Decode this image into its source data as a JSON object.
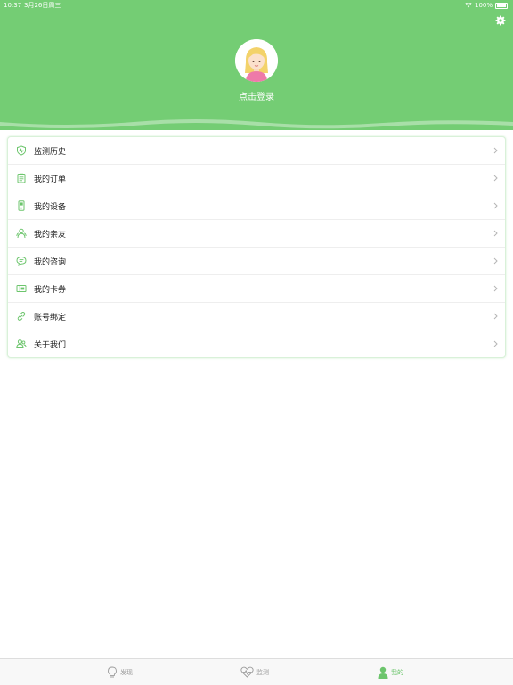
{
  "status_bar": {
    "time": "10:37",
    "date": "3月26日周三",
    "battery": "100%"
  },
  "header": {
    "login_text": "点击登录",
    "background_color": "#74cd74",
    "settings_icon": "gear-icon"
  },
  "menu": {
    "items": [
      {
        "label": "监测历史",
        "icon": "shield-icon"
      },
      {
        "label": "我的订单",
        "icon": "clipboard-icon"
      },
      {
        "label": "我的设备",
        "icon": "device-icon"
      },
      {
        "label": "我的亲友",
        "icon": "friends-icon"
      },
      {
        "label": "我的咨询",
        "icon": "chat-icon"
      },
      {
        "label": "我的卡券",
        "icon": "ticket-icon"
      },
      {
        "label": "账号绑定",
        "icon": "link-icon"
      },
      {
        "label": "关于我们",
        "icon": "people-icon"
      }
    ]
  },
  "tabbar": {
    "tabs": [
      {
        "label": "发现",
        "icon": "lightbulb-icon"
      },
      {
        "label": "监测",
        "icon": "heartbeat-icon"
      },
      {
        "label": "我的",
        "icon": "user-icon"
      }
    ],
    "active_color": "#6cc56c"
  }
}
